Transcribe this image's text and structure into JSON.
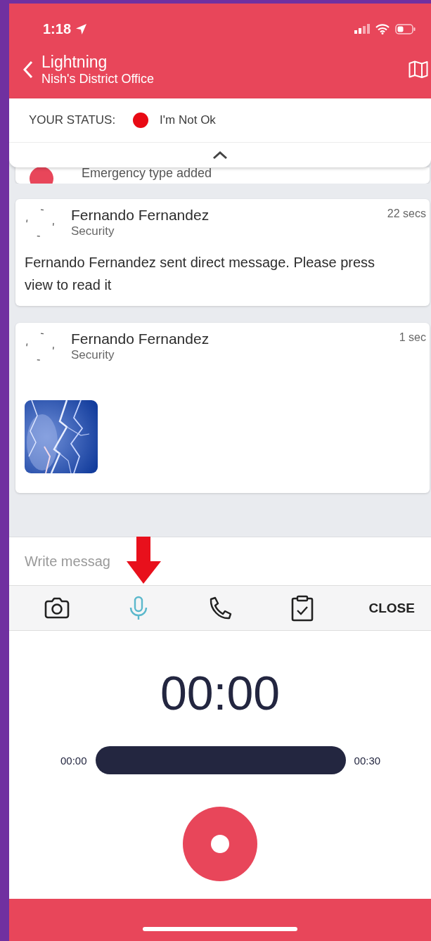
{
  "status_bar": {
    "time": "1:18"
  },
  "header": {
    "title": "Lightning",
    "subtitle": "Nish's District Office"
  },
  "your_status": {
    "label": "YOUR STATUS:",
    "value": "I'm Not Ok",
    "color": "#e80a14",
    "expanded": true
  },
  "feed": [
    {
      "kind": "event",
      "text": "Emergency type added"
    },
    {
      "kind": "message",
      "name": "Fernando Fernandez",
      "role": "Security",
      "time": "22 secs",
      "text": "Fernando Fernandez sent direct message. Please press view to read it"
    },
    {
      "name": "Fernando Fernandez",
      "role": "Security",
      "time": "1 sec"
    }
  ],
  "composer": {
    "placeholder": "Write messag"
  },
  "toolbar": {
    "tools": [
      {
        "kind": "camera",
        "selected": false
      },
      {
        "kind": "microphone",
        "selected": true
      },
      {
        "kind": "phone",
        "selected": false
      },
      {
        "kind": "clipboard",
        "selected": false
      }
    ],
    "close": "CLOSE"
  },
  "recorder": {
    "timer": "00:00",
    "start": "00:00",
    "end": "00:30",
    "level": 0
  }
}
